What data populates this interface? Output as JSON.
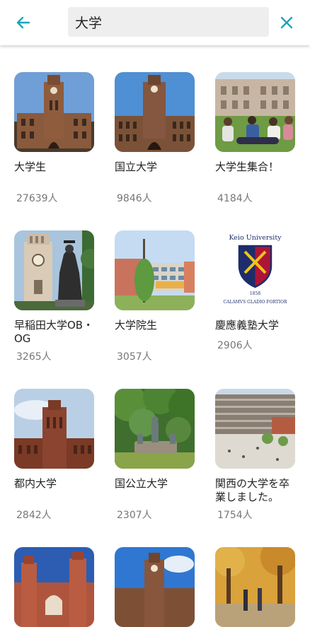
{
  "header": {
    "back_icon": "arrow-left-icon",
    "search_value": "大学",
    "clear_icon": "close-icon",
    "accent_color": "#1aa6b7"
  },
  "groups": [
    {
      "title": "大学生",
      "count": "27639人",
      "image": "clock-tower-university"
    },
    {
      "title": "国立大学",
      "count": "9846人",
      "image": "clock-tower-university"
    },
    {
      "title": "大学生集合！",
      "count": "4184人",
      "image": "students-on-lawn"
    },
    {
      "title": "早稲田大学OB・OG",
      "count": "3265人",
      "image": "tower-and-statue"
    },
    {
      "title": "大学院生",
      "count": "3057人",
      "image": "campus-building-tree"
    },
    {
      "title": "慶應義塾大学",
      "count": "2906人",
      "image": "keio-university-emblem",
      "emblem_text": [
        "Keio University",
        "1858",
        "CALAMVS GLADIO FORTIOR"
      ]
    },
    {
      "title": "都内大学",
      "count": "2842人",
      "image": "brick-tower-sky"
    },
    {
      "title": "国公立大学",
      "count": "2307人",
      "image": "statue-in-trees"
    },
    {
      "title": "関西の大学を卒業しました。",
      "count": "1754人",
      "image": "modern-campus-plaza"
    },
    {
      "title": "",
      "count": "",
      "image": "red-brick-towers"
    },
    {
      "title": "",
      "count": "",
      "image": "clock-tower-blue-sky"
    },
    {
      "title": "",
      "count": "",
      "image": "autumn-campus-walk"
    }
  ]
}
